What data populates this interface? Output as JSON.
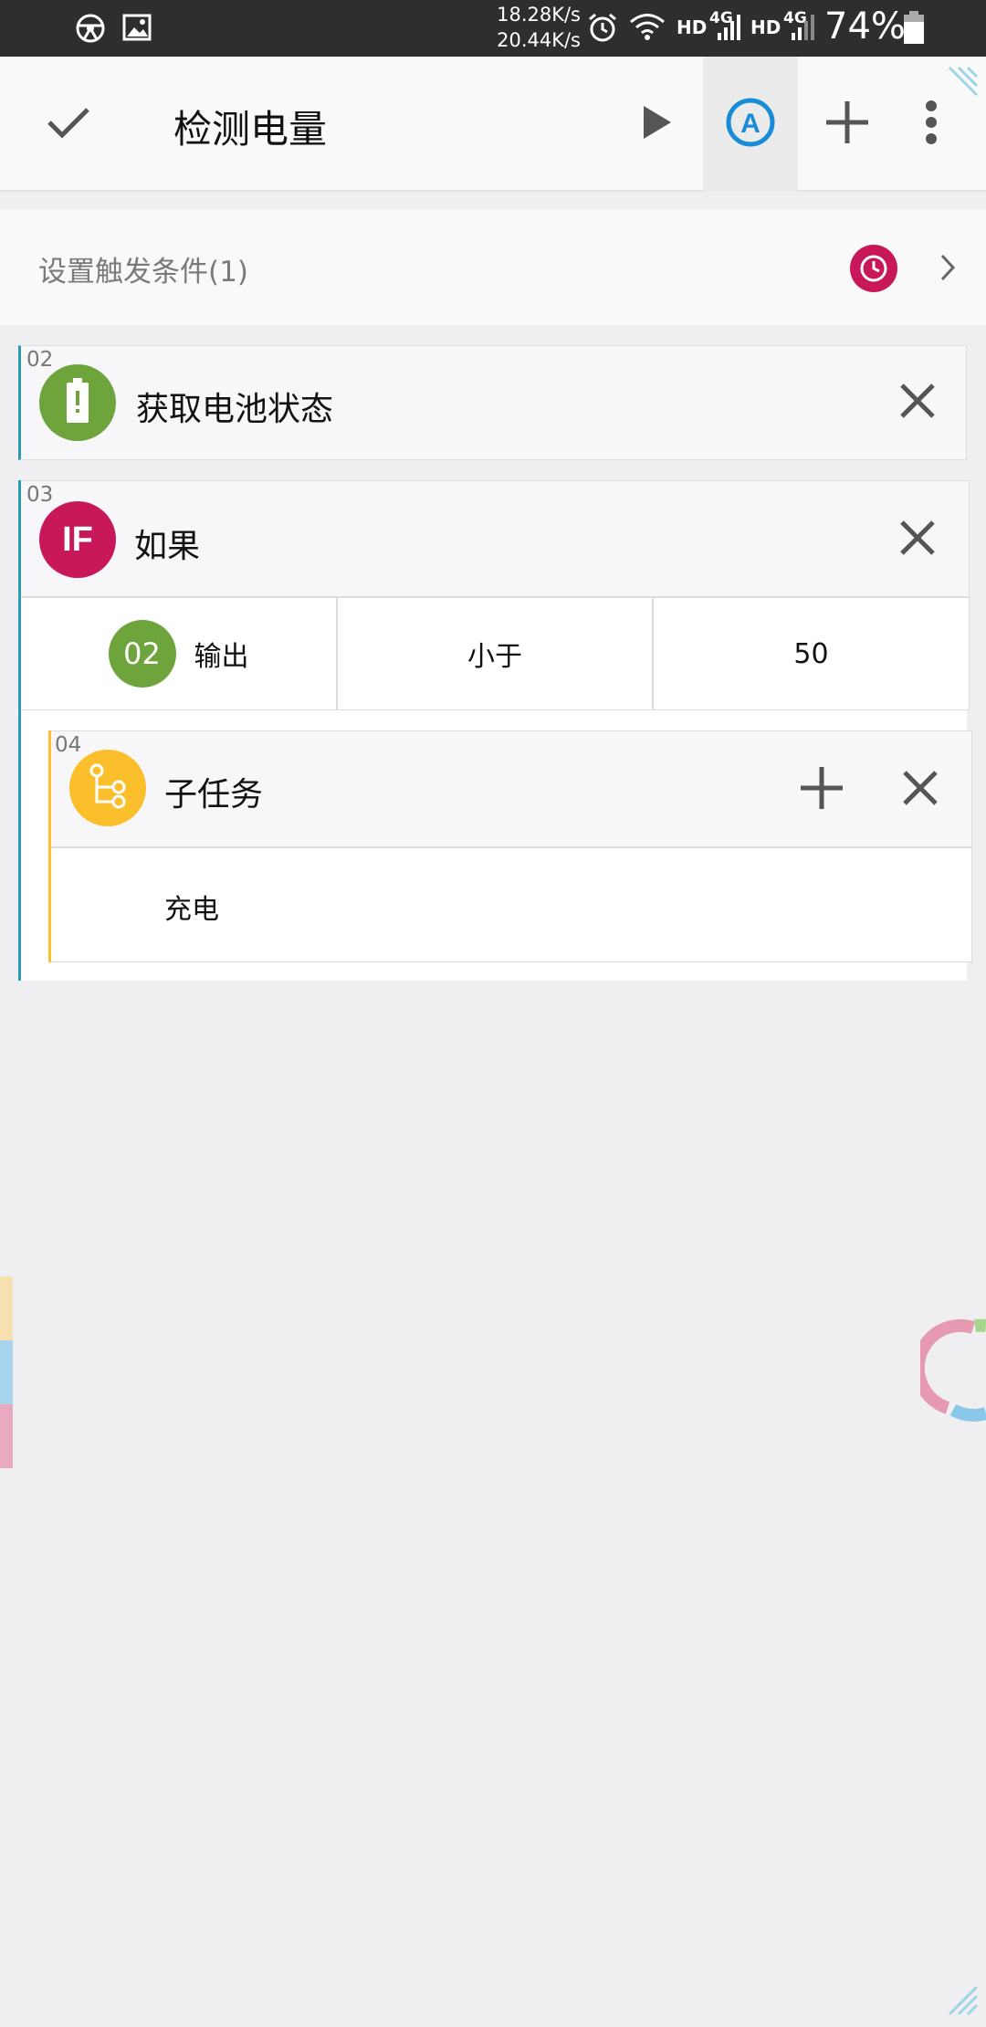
{
  "status_bar": {
    "net_up": "18.28K/s",
    "net_down": "20.44K/s",
    "hd1": "HD",
    "lte1": "4G",
    "hd2": "HD",
    "lte2": "4G",
    "battery": "74%",
    "icons": [
      "steering-wheel-icon",
      "image-icon",
      "alarm-icon",
      "wifi-icon",
      "signal-icon",
      "battery-icon"
    ]
  },
  "toolbar": {
    "title": "检测电量",
    "icons": [
      "check-icon",
      "play-icon",
      "auto-a-icon",
      "plus-icon",
      "more-icon"
    ],
    "accent": "#1a8bd6"
  },
  "trigger": {
    "label": "设置触发条件(1)",
    "badge_color": "#c8185a"
  },
  "steps": [
    {
      "num": "02",
      "title": "获取电池状态",
      "icon": "battery-alert-icon",
      "color": "#6ea43c"
    },
    {
      "num": "03",
      "title": "如果",
      "icon_text": "IF",
      "color": "#c8185a",
      "condition": {
        "ref_num": "02",
        "ref_label": "输出",
        "operator": "小于",
        "value": "50"
      }
    },
    {
      "num": "04",
      "title": "子任务",
      "icon": "tree-icon",
      "color": "#fbbf2b",
      "sub_text": "充电"
    }
  ]
}
